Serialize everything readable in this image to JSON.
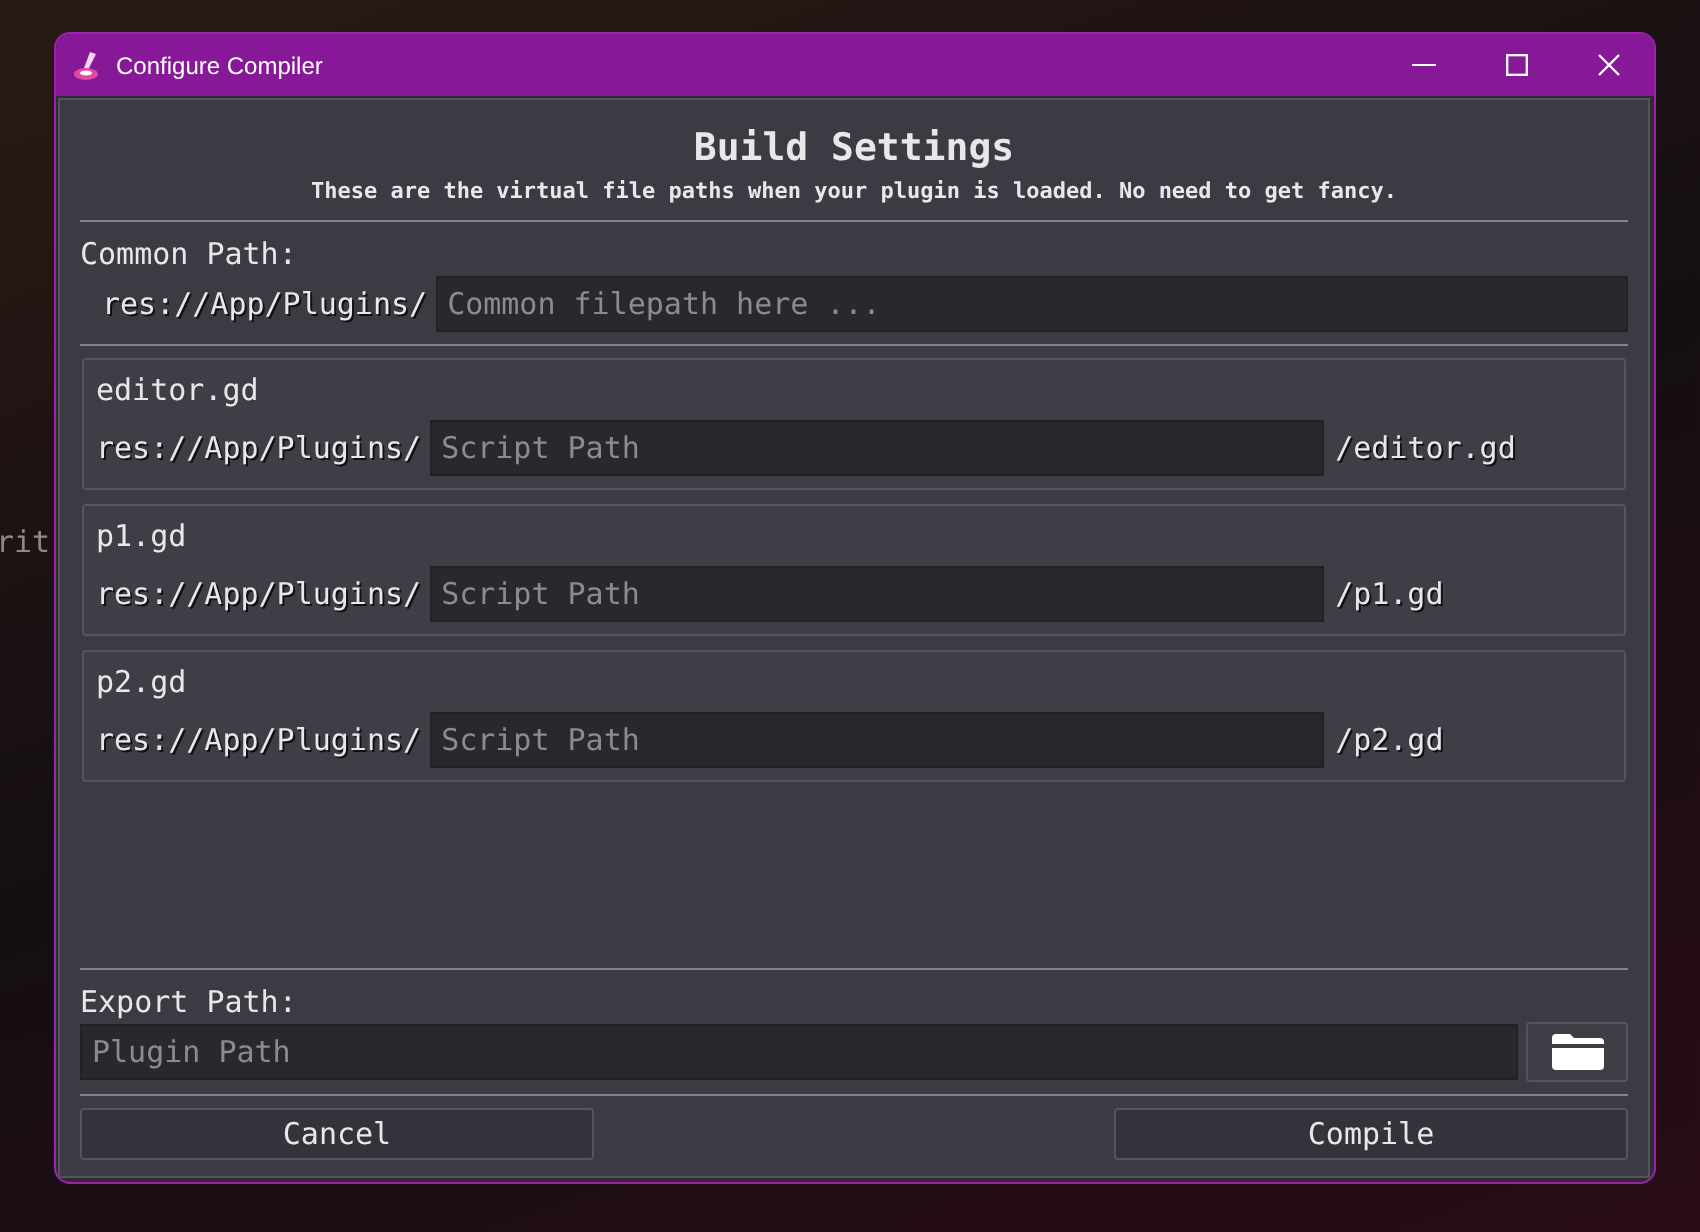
{
  "background_text": "rit",
  "window": {
    "title": "Configure Compiler"
  },
  "heading": "Build Settings",
  "subtitle": "These are the virtual file paths when your plugin is loaded. No need to get fancy.",
  "common_path": {
    "label": "Common Path:",
    "prefix": "res://App/Plugins/",
    "placeholder": "Common filepath here ..."
  },
  "scripts": [
    {
      "name": "editor.gd",
      "prefix": "res://App/Plugins/",
      "placeholder": "Script Path",
      "suffix": "/editor.gd"
    },
    {
      "name": "p1.gd",
      "prefix": "res://App/Plugins/",
      "placeholder": "Script Path",
      "suffix": "/p1.gd"
    },
    {
      "name": "p2.gd",
      "prefix": "res://App/Plugins/",
      "placeholder": "Script Path",
      "suffix": "/p2.gd"
    }
  ],
  "export_path": {
    "label": "Export Path:",
    "placeholder": "Plugin Path"
  },
  "buttons": [
    {
      "label": "Cancel"
    },
    {
      "label": "Compile"
    }
  ]
}
